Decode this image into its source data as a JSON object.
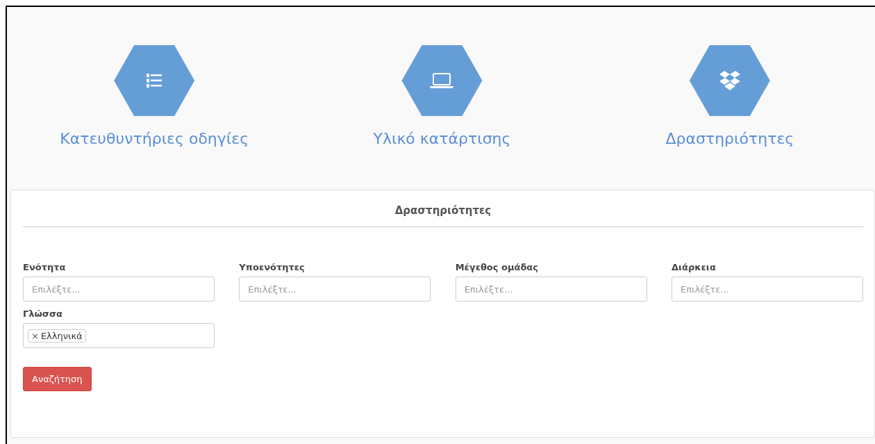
{
  "tiles": [
    {
      "title": "Κατευθυντήριες οδηγίες"
    },
    {
      "title": "Υλικό κατάρτισης"
    },
    {
      "title": "Δραστηριότητες"
    }
  ],
  "panel": {
    "title": "Δραστηριότητες",
    "fields": [
      {
        "label": "Ενότητα",
        "placeholder": "Επιλέξτε..."
      },
      {
        "label": "Υποενότητες",
        "placeholder": "Επιλέξτε..."
      },
      {
        "label": "Μέγεθος ομάδας",
        "placeholder": "Επιλέξτε..."
      },
      {
        "label": "Διάρκεια",
        "placeholder": "Επιλέξτε..."
      },
      {
        "label": "Γλώσσα",
        "tags": [
          {
            "remove": "×",
            "text": "Ελληνικά"
          }
        ]
      }
    ],
    "button": "Αναζήτηση"
  }
}
